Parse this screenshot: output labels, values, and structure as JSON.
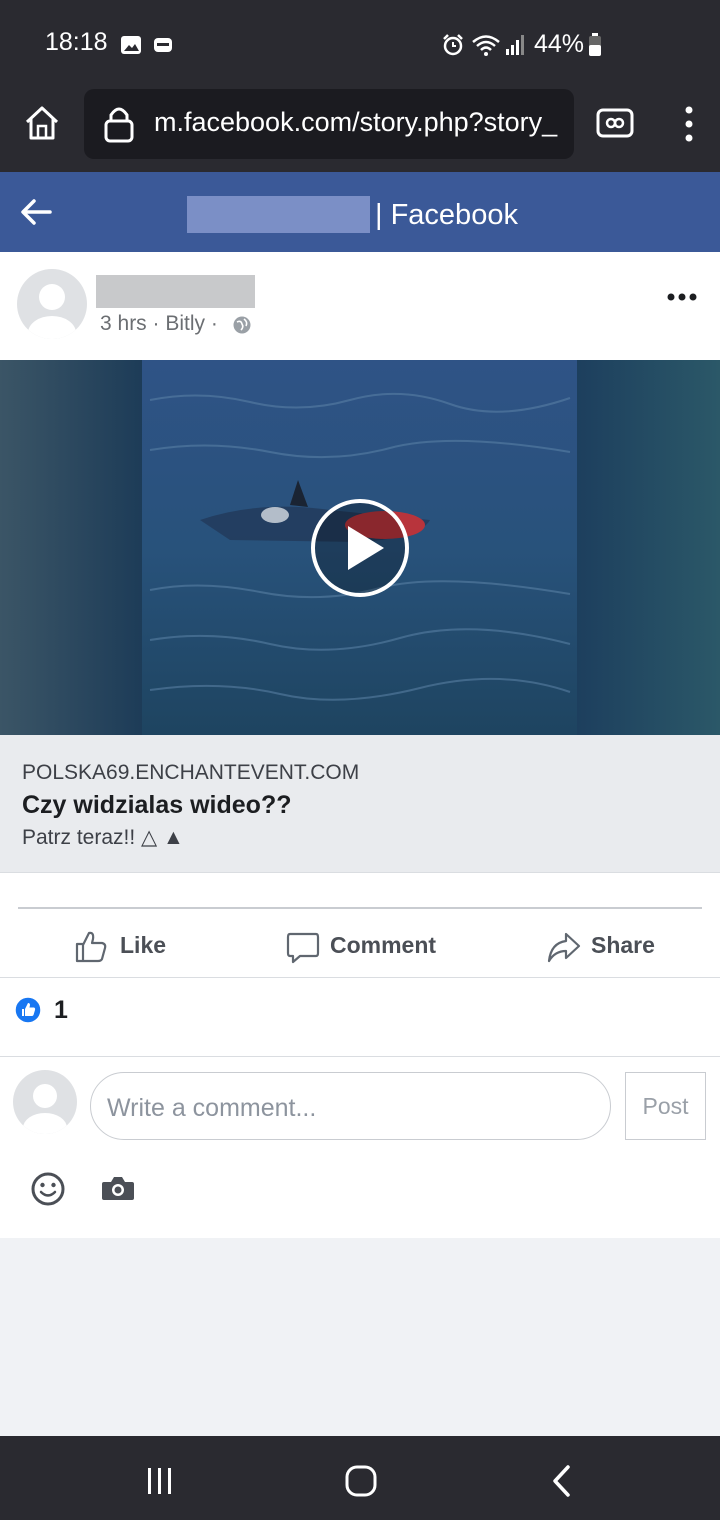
{
  "status_bar": {
    "time": "18:18",
    "battery": "44%"
  },
  "browser": {
    "url": "m.facebook.com/story.php?story_"
  },
  "header": {
    "title": "| Facebook"
  },
  "post": {
    "meta": "3 hrs · Bitly ·",
    "link": {
      "domain": "POLSKA69.ENCHANTEVENT.COM",
      "title": "Czy widzialas wideo??",
      "description": "Patrz teraz!! △ ▲"
    },
    "actions": {
      "like": "Like",
      "comment": "Comment",
      "share": "Share"
    },
    "reaction_count": "1"
  },
  "comment": {
    "placeholder": "Write a comment...",
    "post_label": "Post"
  },
  "colors": {
    "fb_blue": "#3b5998",
    "like_blue": "#1877f2"
  }
}
